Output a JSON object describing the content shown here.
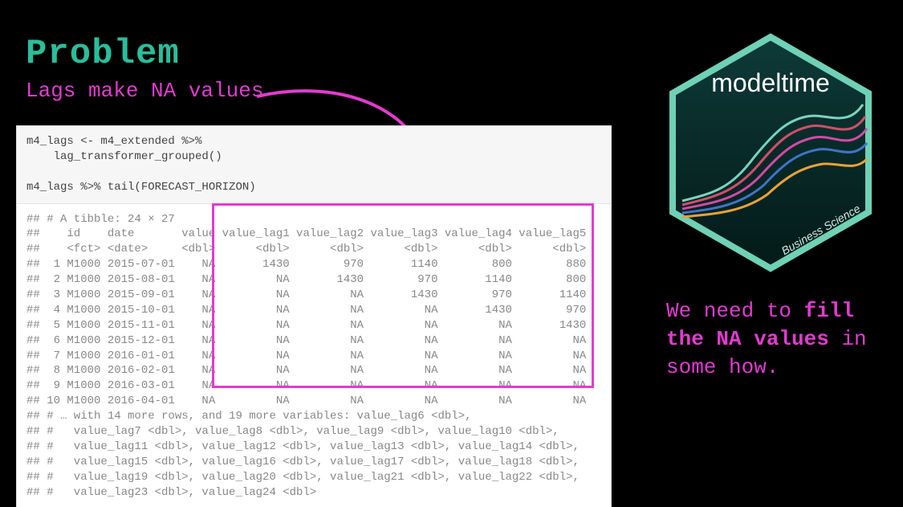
{
  "title": "Problem",
  "subtitle": "Lags make NA values",
  "code_input": "m4_lags <- m4_extended %>%\n    lag_transformer_grouped()\n\nm4_lags %>% tail(FORECAST_HORIZON)",
  "code_output": "## # A tibble: 24 × 27\n##    id    date       value value_lag1 value_lag2 value_lag3 value_lag4 value_lag5\n##    <fct> <date>     <dbl>      <dbl>      <dbl>      <dbl>      <dbl>      <dbl>\n##  1 M1000 2015-07-01    NA       1430        970       1140        800        880\n##  2 M1000 2015-08-01    NA         NA       1430        970       1140        800\n##  3 M1000 2015-09-01    NA         NA         NA       1430        970       1140\n##  4 M1000 2015-10-01    NA         NA         NA         NA       1430        970\n##  5 M1000 2015-11-01    NA         NA         NA         NA         NA       1430\n##  6 M1000 2015-12-01    NA         NA         NA         NA         NA         NA\n##  7 M1000 2016-01-01    NA         NA         NA         NA         NA         NA\n##  8 M1000 2016-02-01    NA         NA         NA         NA         NA         NA\n##  9 M1000 2016-03-01    NA         NA         NA         NA         NA         NA\n## 10 M1000 2016-04-01    NA         NA         NA         NA         NA         NA\n## # … with 14 more rows, and 19 more variables: value_lag6 <dbl>,\n## #   value_lag7 <dbl>, value_lag8 <dbl>, value_lag9 <dbl>, value_lag10 <dbl>,\n## #   value_lag11 <dbl>, value_lag12 <dbl>, value_lag13 <dbl>, value_lag14 <dbl>,\n## #   value_lag15 <dbl>, value_lag16 <dbl>, value_lag17 <dbl>, value_lag18 <dbl>,\n## #   value_lag19 <dbl>, value_lag20 <dbl>, value_lag21 <dbl>, value_lag22 <dbl>,\n## #   value_lag23 <dbl>, value_lag24 <dbl>",
  "caption_prefix": "We need to ",
  "caption_bold": "fill the NA values",
  "caption_suffix": " in some how.",
  "hex": {
    "title": "modeltime",
    "footer": "Business Science"
  },
  "colors": {
    "title": "#2bbd9a",
    "accent": "#e23bd0",
    "hex_border": "#6fd1b5",
    "hex_bg_top": "#0a2a2a",
    "hex_bg_bottom": "#021515"
  }
}
